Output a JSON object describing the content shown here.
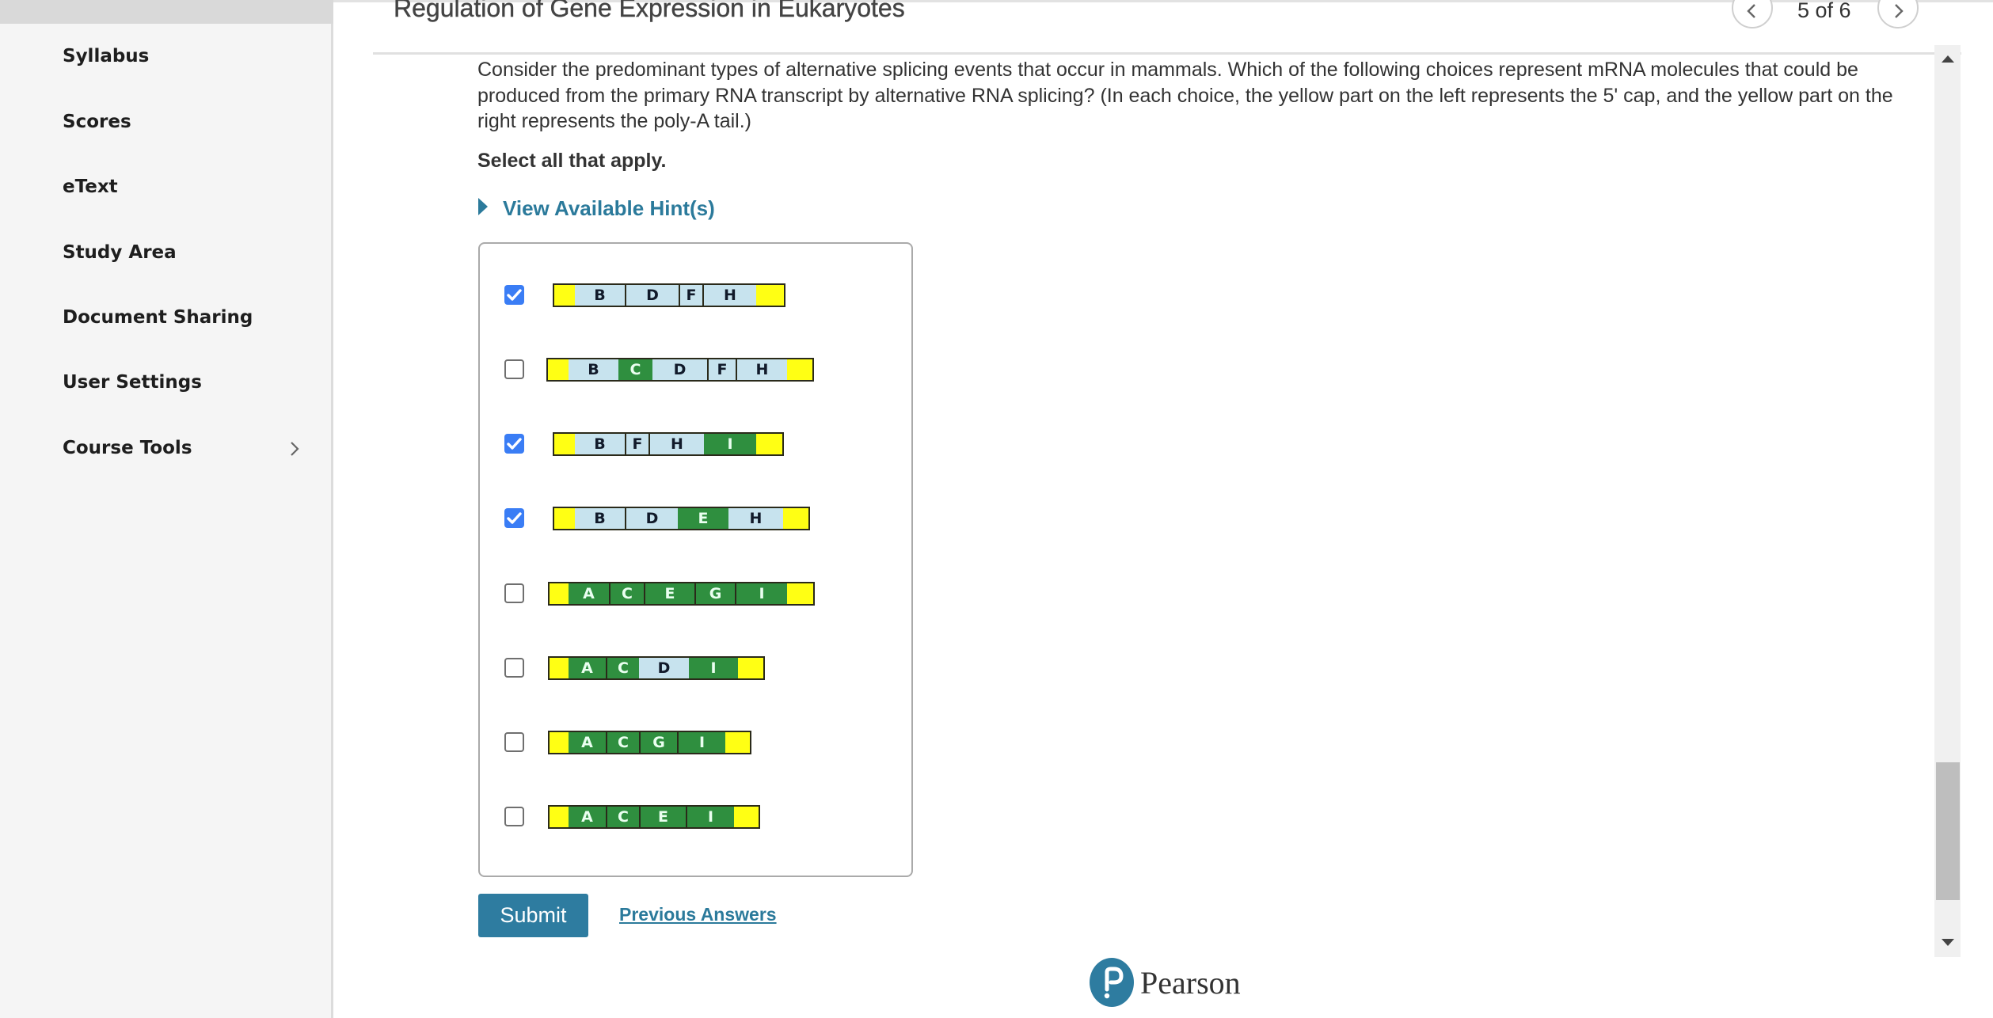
{
  "sidebar": {
    "items": [
      {
        "label": "Syllabus"
      },
      {
        "label": "Scores"
      },
      {
        "label": "eText"
      },
      {
        "label": "Study Area"
      },
      {
        "label": "Document Sharing"
      },
      {
        "label": "User Settings"
      },
      {
        "label": "Course Tools",
        "has_submenu": true
      }
    ]
  },
  "header": {
    "title": "Regulation of Gene Expression in Eukaryotes",
    "pagination": {
      "current": 5,
      "total": 6,
      "text": "5 of 6"
    }
  },
  "question": {
    "text": "Consider the predominant types of alternative splicing events that occur in mammals. Which of the following choices represent mRNA molecules that could be produced from the primary RNA transcript by alternative RNA splicing? (In each choice, the yellow part on the left represents the 5' cap, and the yellow part on the right represents the poly-A tail.)",
    "instruction": "Select all that apply.",
    "hint_label": "View Available Hint(s)"
  },
  "colors": {
    "cap_tail": "#ffff14",
    "exon_blue": "#c7e3ee",
    "exon_green": "#2f8f3f",
    "accent": "#2e7ca0",
    "link": "#2b7a9b",
    "checkbox_checked": "#3a7df5"
  },
  "choices": [
    {
      "checked": true,
      "exons": [
        {
          "label": "B",
          "color": "blue"
        },
        {
          "label": "D",
          "color": "blue"
        },
        {
          "label": "F",
          "color": "blue"
        },
        {
          "label": "H",
          "color": "blue"
        }
      ]
    },
    {
      "checked": false,
      "exons": [
        {
          "label": "B",
          "color": "blue"
        },
        {
          "label": "C",
          "color": "green"
        },
        {
          "label": "D",
          "color": "blue"
        },
        {
          "label": "F",
          "color": "blue"
        },
        {
          "label": "H",
          "color": "blue"
        }
      ]
    },
    {
      "checked": true,
      "exons": [
        {
          "label": "B",
          "color": "blue"
        },
        {
          "label": "F",
          "color": "blue"
        },
        {
          "label": "H",
          "color": "blue"
        },
        {
          "label": "I",
          "color": "green"
        }
      ]
    },
    {
      "checked": true,
      "exons": [
        {
          "label": "B",
          "color": "blue"
        },
        {
          "label": "D",
          "color": "blue"
        },
        {
          "label": "E",
          "color": "green"
        },
        {
          "label": "H",
          "color": "blue"
        }
      ]
    },
    {
      "checked": false,
      "exons": [
        {
          "label": "A",
          "color": "green"
        },
        {
          "label": "C",
          "color": "green"
        },
        {
          "label": "E",
          "color": "green"
        },
        {
          "label": "G",
          "color": "green"
        },
        {
          "label": "I",
          "color": "green"
        }
      ]
    },
    {
      "checked": false,
      "exons": [
        {
          "label": "A",
          "color": "green"
        },
        {
          "label": "C",
          "color": "green"
        },
        {
          "label": "D",
          "color": "blue"
        },
        {
          "label": "I",
          "color": "green"
        }
      ]
    },
    {
      "checked": false,
      "exons": [
        {
          "label": "A",
          "color": "green"
        },
        {
          "label": "C",
          "color": "green"
        },
        {
          "label": "G",
          "color": "green"
        },
        {
          "label": "I",
          "color": "green"
        }
      ]
    },
    {
      "checked": false,
      "exons": [
        {
          "label": "A",
          "color": "green"
        },
        {
          "label": "C",
          "color": "green"
        },
        {
          "label": "E",
          "color": "green"
        },
        {
          "label": "I",
          "color": "green"
        }
      ]
    }
  ],
  "actions": {
    "submit_label": "Submit",
    "previous_answers_label": "Previous Answers"
  },
  "footer": {
    "logo_text": "Pearson"
  }
}
